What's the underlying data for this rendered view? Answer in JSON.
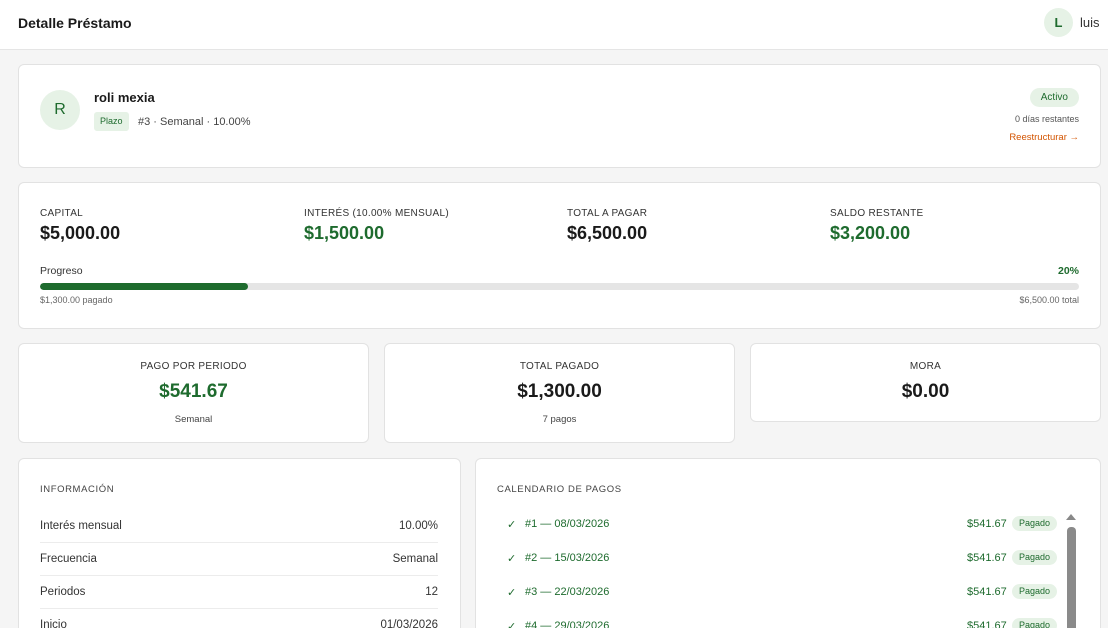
{
  "header": {
    "title": "Detalle Préstamo",
    "user_initial": "L",
    "user_name": "luis"
  },
  "client": {
    "initial": "R",
    "name": "roli mexia",
    "type": "Plazo",
    "meta": "#3 · Semanal · 10.00%",
    "status": "Activo",
    "days_left": "0 días restantes",
    "restructure": "Reestructurar →"
  },
  "summary": {
    "capital_label": "CAPITAL",
    "capital": "$5,000.00",
    "interest_label": "INTERÉS (10.00% MENSUAL)",
    "interest": "$1,500.00",
    "total_label": "TOTAL A PAGAR",
    "total": "$6,500.00",
    "balance_label": "SALDO RESTANTE",
    "balance": "$3,200.00",
    "progress_label": "Progreso",
    "progress_text": "20%",
    "progress_fraction": 0.2,
    "paid_note": "$1,300.00 pagado",
    "total_note": "$6,500.00 total"
  },
  "stats": [
    {
      "label": "PAGO POR PERIODO",
      "value": "$541.67",
      "sub": "Semanal"
    },
    {
      "label": "TOTAL PAGADO",
      "value": "$1,300.00",
      "sub": "7 pagos"
    },
    {
      "label": "MORA",
      "value": "$0.00",
      "sub": ""
    }
  ],
  "info": {
    "title": "INFORMACIÓN",
    "rows": [
      {
        "key": "Interés mensual",
        "value": "10.00%"
      },
      {
        "key": "Frecuencia",
        "value": "Semanal"
      },
      {
        "key": "Periodos",
        "value": "12"
      },
      {
        "key": "Inicio",
        "value": "01/03/2026"
      }
    ]
  },
  "schedule": {
    "title": "CALENDARIO DE PAGOS",
    "rows": [
      {
        "label": "#1 — 08/03/2026",
        "amount": "$541.67",
        "status": "Pagado"
      },
      {
        "label": "#2 — 15/03/2026",
        "amount": "$541.67",
        "status": "Pagado"
      },
      {
        "label": "#3 — 22/03/2026",
        "amount": "$541.67",
        "status": "Pagado"
      },
      {
        "label": "#4 — 29/03/2026",
        "amount": "$541.67",
        "status": "Pagado"
      }
    ]
  }
}
